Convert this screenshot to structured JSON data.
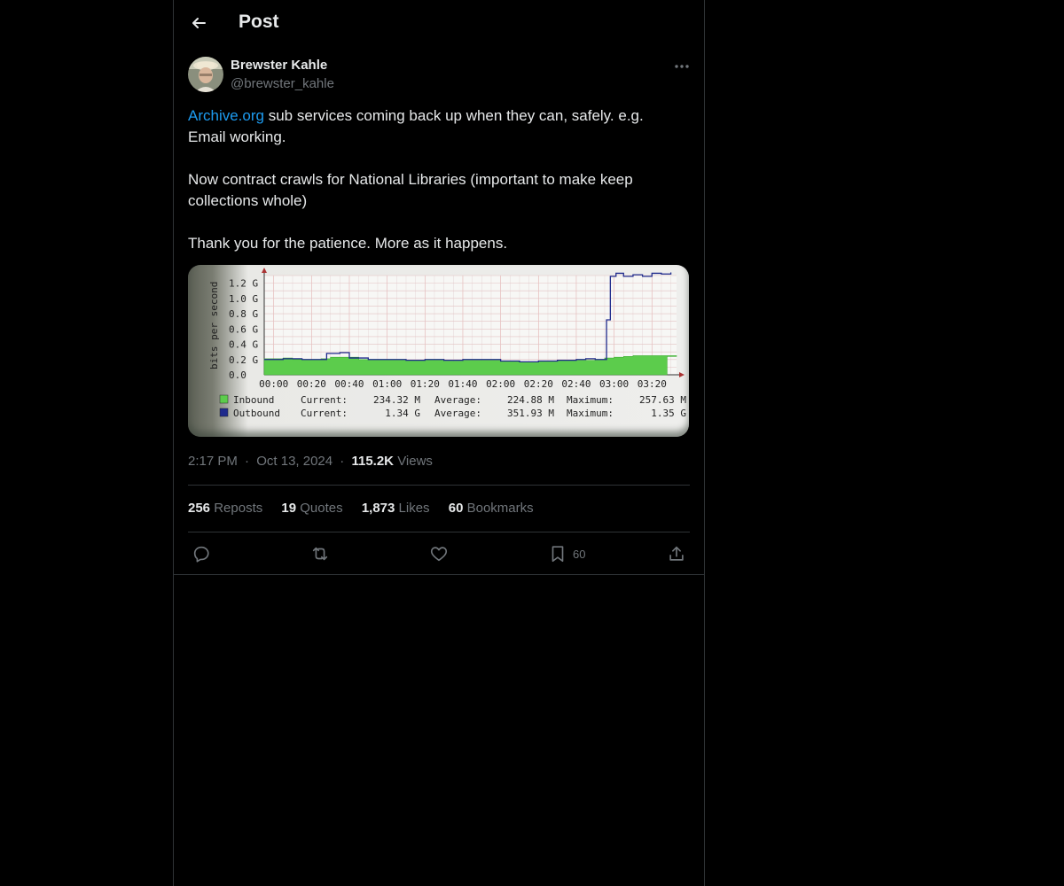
{
  "header": {
    "title": "Post",
    "back_icon": "arrow-left-icon"
  },
  "author": {
    "name": "Brewster Kahle",
    "handle": "@brewster_kahle"
  },
  "post": {
    "link_text": "Archive.org",
    "line1_rest": " sub services coming back up when they can, safely.  e.g. Email working.",
    "paragraph2": "Now contract crawls for National Libraries (important to make keep collections whole)",
    "paragraph3": "Thank you for the patience.   More as it happens."
  },
  "meta": {
    "time": "2:17 PM",
    "date": "Oct 13, 2024",
    "views_count": "115.2K",
    "views_label": "Views",
    "dot": "·"
  },
  "stats": {
    "reposts_count": "256",
    "reposts_label": "Reposts",
    "quotes_count": "19",
    "quotes_label": "Quotes",
    "likes_count": "1,873",
    "likes_label": "Likes",
    "bookmarks_count": "60",
    "bookmarks_label": "Bookmarks"
  },
  "actions": {
    "bookmark_count": "60"
  },
  "colors": {
    "accent": "#1d9bf0",
    "inbound": "#5ccc4c",
    "outbound": "#1f2a8c"
  },
  "chart_data": {
    "type": "area",
    "ylabel": "bits per second",
    "x": [
      "00:00",
      "00:20",
      "00:40",
      "01:00",
      "01:20",
      "01:40",
      "02:00",
      "02:20",
      "02:40",
      "03:00",
      "03:20"
    ],
    "ytick_labels": [
      "0.0",
      "0.2 G",
      "0.4 G",
      "0.6 G",
      "0.8 G",
      "1.0 G",
      "1.2 G"
    ],
    "ylim_gbps": [
      0,
      1.3
    ],
    "xlim_minutes": [
      -5,
      213
    ],
    "series": [
      {
        "name": "Inbound",
        "minutes": [
          -5,
          5,
          10,
          25,
          30,
          45,
          60,
          70,
          80,
          90,
          100,
          110,
          120,
          130,
          140,
          150,
          160,
          170,
          175,
          180,
          185,
          190,
          200,
          213
        ],
        "values_gbps": [
          0.21,
          0.22,
          0.2,
          0.21,
          0.23,
          0.2,
          0.2,
          0.19,
          0.2,
          0.18,
          0.19,
          0.19,
          0.18,
          0.17,
          0.18,
          0.19,
          0.19,
          0.2,
          0.22,
          0.23,
          0.24,
          0.25,
          0.25,
          0.24
        ],
        "current": "234.32 M",
        "average": "224.88 M",
        "maximum": "257.63 M"
      },
      {
        "name": "Outbound",
        "minutes": [
          -5,
          5,
          15,
          25,
          28,
          35,
          40,
          50,
          60,
          70,
          80,
          90,
          100,
          110,
          120,
          130,
          140,
          150,
          160,
          165,
          170,
          176,
          178,
          181,
          185,
          190,
          195,
          200,
          205,
          210
        ],
        "values_gbps": [
          0.2,
          0.21,
          0.2,
          0.2,
          0.28,
          0.29,
          0.22,
          0.2,
          0.2,
          0.19,
          0.2,
          0.19,
          0.2,
          0.2,
          0.18,
          0.17,
          0.18,
          0.19,
          0.2,
          0.21,
          0.2,
          0.72,
          1.29,
          1.33,
          1.29,
          1.31,
          1.29,
          1.33,
          1.32,
          1.34
        ],
        "current": "1.34 G",
        "average": "351.93 M",
        "maximum": "1.35 G"
      }
    ],
    "legend_labels": {
      "current": "Current:",
      "average": "Average:",
      "maximum": "Maximum:"
    }
  }
}
